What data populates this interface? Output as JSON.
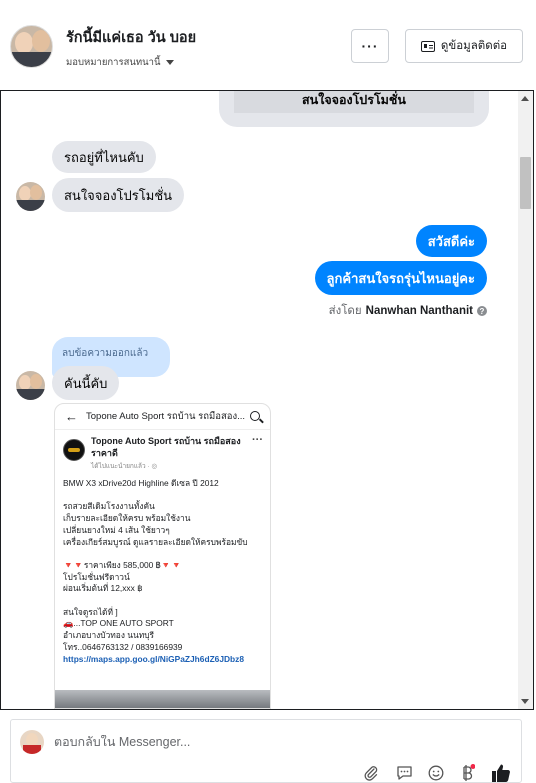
{
  "header": {
    "name": "รักนี้มีแค่เธอ วัน บอย",
    "assign_label": "มอบหมายการสนทนานี้",
    "more_label": "···",
    "contact_label": "ดูข้อมูลติดต่อ"
  },
  "chat": {
    "quoted_text": "สนใจจองโปรโมชั่น",
    "incoming_1": "รถอยู่ที่ไหนคับ",
    "incoming_2": "สนใจจองโปรโมชั่น",
    "outgoing_1": "สวัสดีค่ะ",
    "outgoing_2": "ลูกค้าสนใจรถรุ่นไหนอยู่คะ",
    "sent_by_prefix": "ส่งโดย",
    "sent_by_name": "Nanwhan Nanthanit",
    "deleted_text": "ลบข้อความออกแล้ว",
    "incoming_3": "คันนี้คับ"
  },
  "post": {
    "top_title": "Topone Auto Sport รถบ้าน รถมือสอง...",
    "page_name": "Topone Auto Sport รถบ้าน รถมือสอง ราคาดี",
    "meta": "ได้ไปแนะนำยกแล้ว · ◎",
    "lines": [
      "BMW X3 xDrive20d Highline ดีเซล ปี 2012",
      "",
      "รถสวยสีเดิมโรงงานทั้งคัน",
      "เก็บรายละเอียดให้ครบ พร้อมใช้งาน",
      "เปลี่ยนยางใหม่ 4 เส้น ใช้ยาวๆ",
      "เครื่องเกียร์สมบูรณ์ ดูแลรายละเอียดให้ครบพร้อมขับ",
      "",
      "🔻🔻ราคาเพียง 585,000 ฿🔻🔻",
      "       โปรโมชั่นฟรีดาวน์",
      "    ผ่อนเริ่มต้นที่ 12,xxx ฿",
      "",
      "     สนใจดูรถได้ที่ ]",
      "🚗...TOP ONE AUTO SPORT",
      "   อำเภอบางบัวทอง นนทบุรี",
      "โทร..0646763132 / 0839166939"
    ],
    "link": "https://maps.app.goo.gl/NiGPaZJh6dZ6JDbz8"
  },
  "reply": {
    "placeholder": "ตอบกลับใน Messenger..."
  },
  "icons": [
    "more-icon",
    "id-card-icon",
    "info-icon",
    "back-arrow-icon",
    "search-icon",
    "attachment-icon",
    "saved-reply-icon",
    "emoji-icon",
    "baht-icon",
    "thumbs-up-icon"
  ],
  "colors": {
    "outgoing_bubble": "#0084ff",
    "incoming_bubble": "#e4e6eb",
    "deleted_bubble": "#cfe5ff",
    "like": "#1c1e21"
  }
}
